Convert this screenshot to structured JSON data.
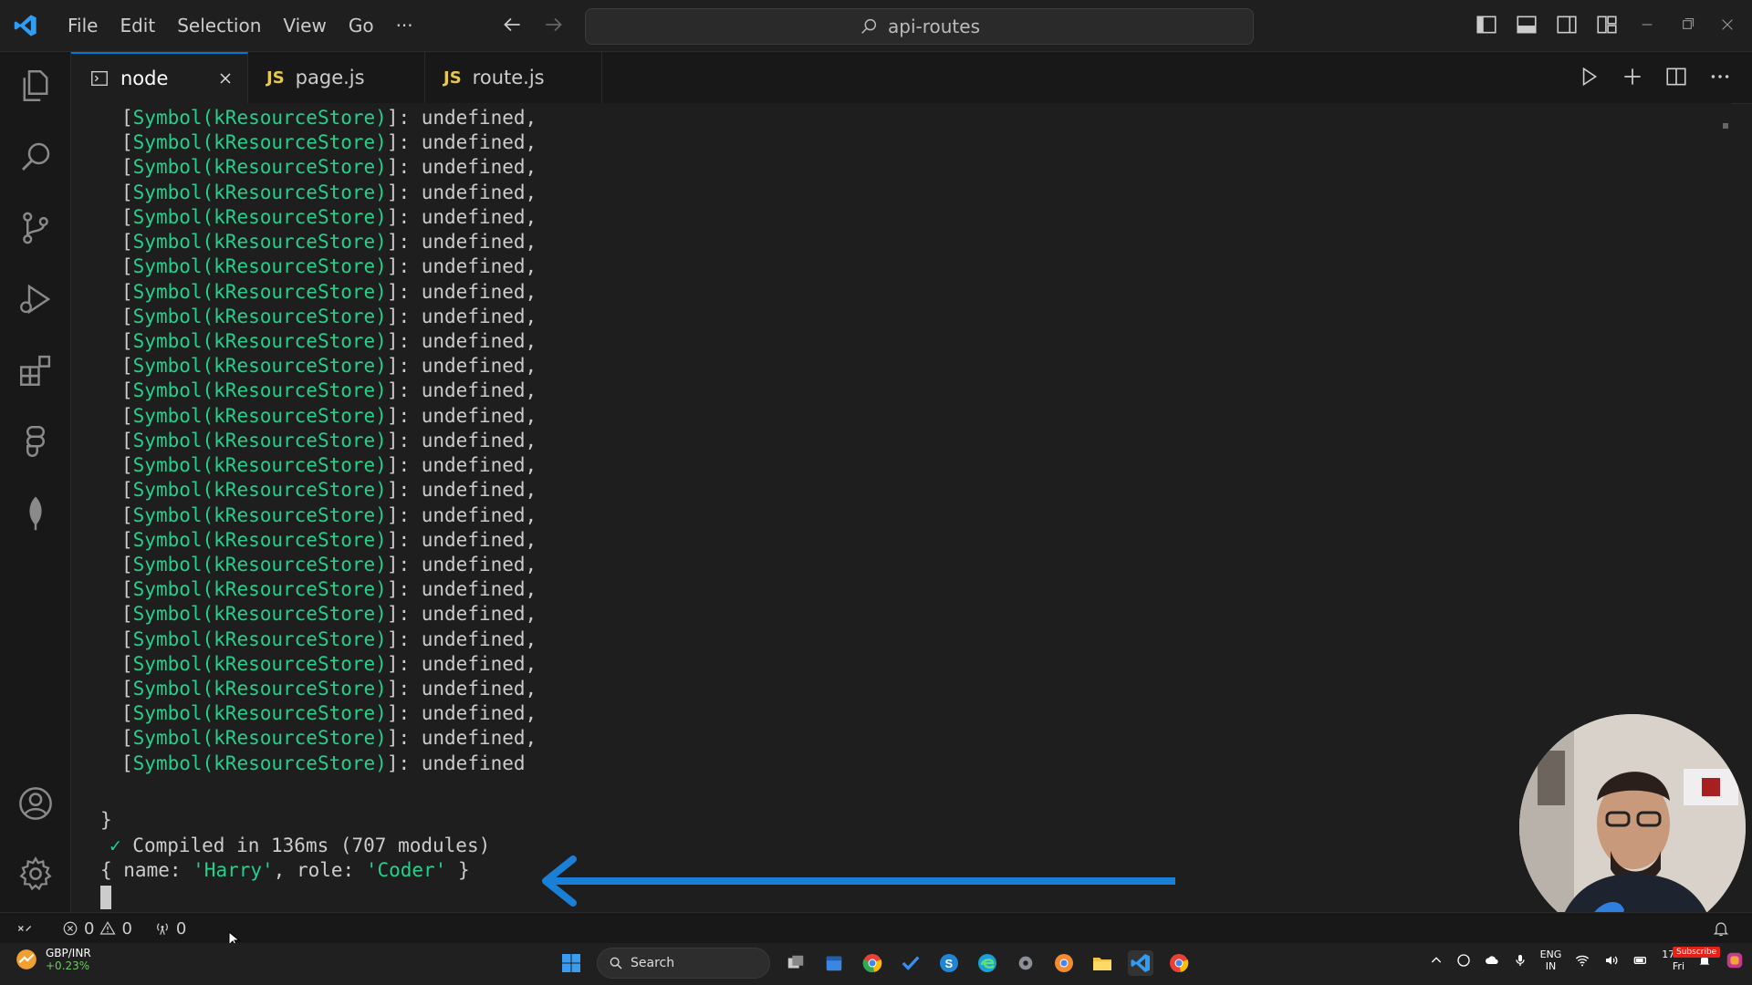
{
  "menu": [
    "File",
    "Edit",
    "Selection",
    "View",
    "Go",
    "···"
  ],
  "command_center": {
    "text": "api-routes"
  },
  "tabs": [
    {
      "label": "node",
      "icon": "terminal-icon",
      "active": true
    },
    {
      "label": "page.js",
      "icon": "js-file-icon",
      "badge": "JS"
    },
    {
      "label": "route.js",
      "icon": "js-file-icon",
      "badge": "JS"
    }
  ],
  "terminal": {
    "symbol_line": {
      "open": "[",
      "symbol": "Symbol(kResourceStore)",
      "close": "]: ",
      "value": "undefined",
      "comma": ","
    },
    "symbol_line_count": 27,
    "last_symbol_line": {
      "open": "[",
      "symbol": "Symbol(kResourceStore)",
      "close": "]: ",
      "value": "undefined"
    },
    "closing_brace": "}",
    "compiled": {
      "check": "✓",
      "text": " Compiled in 136ms (707 modules)"
    },
    "output": {
      "prefix": "{ name: ",
      "name": "'Harry'",
      "middle": ", role: ",
      "role": "'Coder'",
      "suffix": " }"
    }
  },
  "statusbar": {
    "errors": "0",
    "warnings": "0",
    "ports": "0"
  },
  "taskbar": {
    "stock_name": "GBP/INR",
    "stock_change": "+0.23%",
    "search_label": "Search",
    "lang_top": "ENG",
    "lang_bottom": "IN",
    "time": "17:4",
    "day": "Fri",
    "subscribe": "Subscribe"
  },
  "colors": {
    "accent": "#0078d4",
    "terminal_green": "#23d18b",
    "arrow_blue": "#1a7fd6"
  }
}
